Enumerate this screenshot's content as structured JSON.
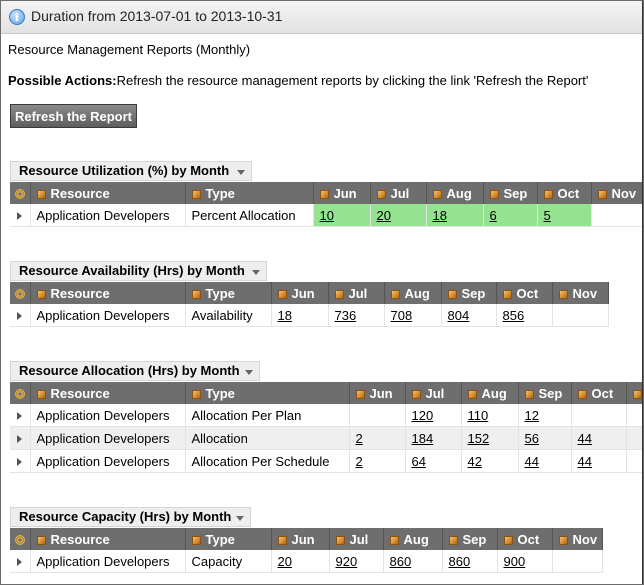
{
  "window": {
    "title": "Duration from 2013-07-01 to 2013-10-31"
  },
  "intro": {
    "heading": "Resource Management Reports (Monthly)",
    "actions_label": "Possible Actions:",
    "actions_text": "Refresh the resource management reports by clicking the link 'Refresh the Report'",
    "refresh_button": "Refresh the Report"
  },
  "sections": [
    {
      "title": "Resource Utilization (%) by Month",
      "columns": [
        "Resource",
        "Type",
        "Jun",
        "Jul",
        "Aug",
        "Sep",
        "Oct",
        "Nov"
      ],
      "rows": [
        {
          "resource": "Application Developers",
          "type": "Percent Allocation",
          "values": [
            "10",
            "20",
            "18",
            "6",
            "5",
            ""
          ]
        }
      ]
    },
    {
      "title": "Resource Availability (Hrs) by Month",
      "columns": [
        "Resource",
        "Type",
        "Jun",
        "Jul",
        "Aug",
        "Sep",
        "Oct",
        "Nov"
      ],
      "rows": [
        {
          "resource": "Application Developers",
          "type": "Availability",
          "values": [
            "18",
            "736",
            "708",
            "804",
            "856",
            ""
          ]
        }
      ]
    },
    {
      "title": "Resource Allocation (Hrs) by Month",
      "columns": [
        "Resource",
        "Type",
        "Jun",
        "Jul",
        "Aug",
        "Sep",
        "Oct",
        "Nov"
      ],
      "rows": [
        {
          "resource": "Application Developers",
          "type": "Allocation Per Plan",
          "values": [
            "",
            "120",
            "110",
            "12",
            "",
            ""
          ]
        },
        {
          "resource": "Application Developers",
          "type": "Allocation",
          "values": [
            "2",
            "184",
            "152",
            "56",
            "44",
            ""
          ]
        },
        {
          "resource": "Application Developers",
          "type": "Allocation Per Schedule",
          "values": [
            "2",
            "64",
            "42",
            "44",
            "44",
            ""
          ]
        }
      ]
    },
    {
      "title": "Resource Capacity (Hrs) by Month",
      "columns": [
        "Resource",
        "Type",
        "Jun",
        "Jul",
        "Aug",
        "Sep",
        "Oct",
        "Nov"
      ],
      "rows": [
        {
          "resource": "Application Developers",
          "type": "Capacity",
          "values": [
            "20",
            "920",
            "860",
            "860",
            "900",
            ""
          ]
        }
      ]
    }
  ],
  "colors": {
    "header_bg": "#6e6e6e",
    "highlight": "#95e391",
    "button_bg": "#6e6e6e"
  },
  "icons": {
    "title": "info-icon",
    "header_settings": "gear-icon",
    "column": "cube-icon",
    "row_expand": "expand-arrow-icon"
  }
}
